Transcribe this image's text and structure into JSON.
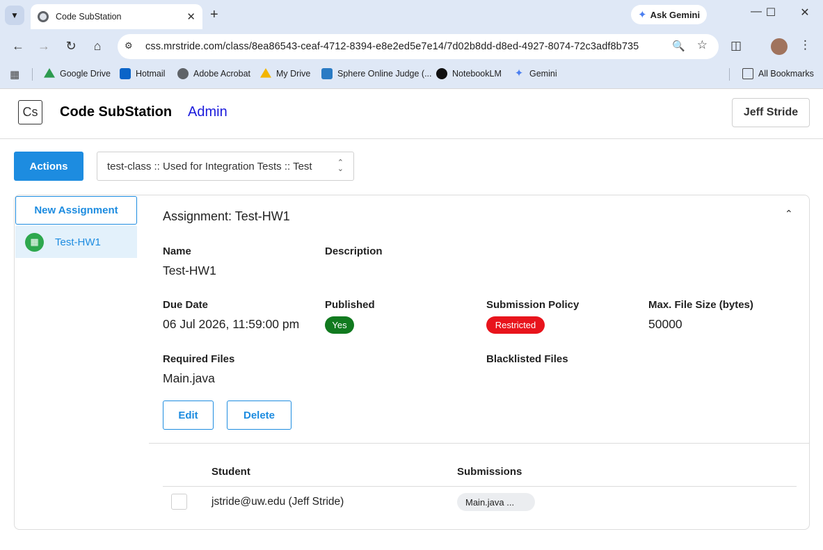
{
  "browser": {
    "tab_title": "Code SubStation",
    "new_tab_symbol": "+",
    "ask_gemini": "Ask Gemini",
    "url": "css.mrstride.com/class/8ea86543-ceaf-4712-8394-e8e2ed5e7e14/7d02b8dd-d8ed-4927-8074-72c3adf8b735",
    "bookmarks": [
      {
        "label": "Google Drive",
        "icon": "google-drive-icon",
        "color": "#2d9a4f"
      },
      {
        "label": "Hotmail",
        "icon": "outlook-icon",
        "color": "#0a64c8"
      },
      {
        "label": "Adobe Acrobat",
        "icon": "globe-icon",
        "color": "#5f6368"
      },
      {
        "label": "My Drive",
        "icon": "google-drive-icon",
        "color": "#f2b500"
      },
      {
        "label": "Sphere Online Judge (...",
        "icon": "spoj-icon",
        "color": "#2a7bc4"
      },
      {
        "label": "NotebookLM",
        "icon": "notebooklm-icon",
        "color": "#111111"
      },
      {
        "label": "Gemini",
        "icon": "gemini-icon",
        "color": "#4b7ff0"
      }
    ],
    "all_bookmarks": "All Bookmarks"
  },
  "app": {
    "logo": "Cs",
    "brand": "Code SubStation",
    "role": "Admin",
    "user": "Jeff Stride",
    "actions_label": "Actions",
    "class_selector": "test-class :: Used for Integration Tests :: Test",
    "accent_color": "#1d8ce0"
  },
  "sidebar": {
    "new_assignment": "New Assignment",
    "items": [
      {
        "label": "Test-HW1"
      }
    ]
  },
  "assignment": {
    "title": "Assignment: Test-HW1",
    "name_label": "Name",
    "name": "Test-HW1",
    "description_label": "Description",
    "description": "",
    "due_label": "Due Date",
    "due": "06 Jul 2026, 11:59:00 pm",
    "published_label": "Published",
    "published": "Yes",
    "policy_label": "Submission Policy",
    "policy": "Restricted",
    "maxsize_label": "Max. File Size (bytes)",
    "maxsize": "50000",
    "required_label": "Required Files",
    "required": "Main.java",
    "blacklisted_label": "Blacklisted Files",
    "blacklisted": "",
    "edit_label": "Edit",
    "delete_label": "Delete"
  },
  "table": {
    "columns": [
      "Student",
      "Submissions"
    ],
    "rows": [
      {
        "student": "jstride@uw.edu (Jeff Stride)",
        "submission": "Main.java ..."
      }
    ]
  }
}
